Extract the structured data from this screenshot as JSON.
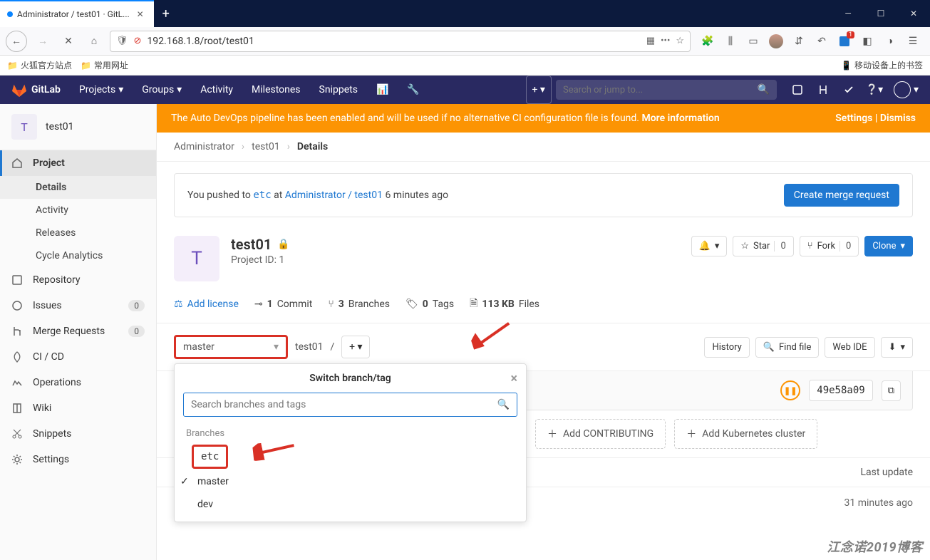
{
  "window": {
    "tab_title": "Administrator / test01 · GitL...",
    "url": "192.168.1.8/root/test01"
  },
  "bookmarks_bar": {
    "item1": "火狐官方站点",
    "item2": "常用网址",
    "mobile": "移动设备上的书签"
  },
  "gl_header": {
    "brand": "GitLab",
    "nav": {
      "projects": "Projects",
      "groups": "Groups",
      "activity": "Activity",
      "milestones": "Milestones",
      "snippets": "Snippets"
    },
    "search_ph": "Search or jump to..."
  },
  "sidebar": {
    "project_initial": "T",
    "project_name": "test01",
    "project": "Project",
    "details": "Details",
    "activity": "Activity",
    "releases": "Releases",
    "cycle": "Cycle Analytics",
    "repository": "Repository",
    "issues": "Issues",
    "issues_count": "0",
    "mr": "Merge Requests",
    "mr_count": "0",
    "cicd": "CI / CD",
    "operations": "Operations",
    "wiki": "Wiki",
    "snippets": "Snippets",
    "settings": "Settings"
  },
  "banner": {
    "text": "The Auto DevOps pipeline has been enabled and will be used if no alternative CI configuration file is found. ",
    "more": "More information",
    "settings": "Settings",
    "dismiss": "Dismiss"
  },
  "crumbs": {
    "a": "Administrator",
    "b": "test01",
    "c": "Details"
  },
  "push": {
    "pre": "You pushed to ",
    "branch": "etc",
    "at": " at ",
    "proj": "Administrator / test01",
    "ago": " 6 minutes ago",
    "btn": "Create merge request"
  },
  "project": {
    "initial": "T",
    "name": "test01",
    "idlabel": "Project ID: 1",
    "star": "Star",
    "star_c": "0",
    "fork": "Fork",
    "fork_c": "0",
    "clone": "Clone"
  },
  "stats": {
    "license": "Add license",
    "commits_n": "1",
    "commits": "Commit",
    "branches_n": "3",
    "branches": "Branches",
    "tags_n": "0",
    "tags": "Tags",
    "size_n": "113 KB",
    "size": "Files"
  },
  "repo": {
    "branch": "master",
    "path": "test01",
    "history": "History",
    "find": "Find file",
    "webide": "Web IDE"
  },
  "dropdown": {
    "title": "Switch branch/tag",
    "search_ph": "Search branches and tags",
    "label": "Branches",
    "etc": "etc",
    "master": "master",
    "dev": "dev"
  },
  "commit": {
    "hash": "49e58a09"
  },
  "addrow": {
    "contrib": "Add CONTRIBUTING",
    "kube": "Add Kubernetes cluster"
  },
  "table": {
    "last_update": "Last update",
    "ago": "31 minutes ago"
  },
  "watermark": "江念诺2019博客"
}
